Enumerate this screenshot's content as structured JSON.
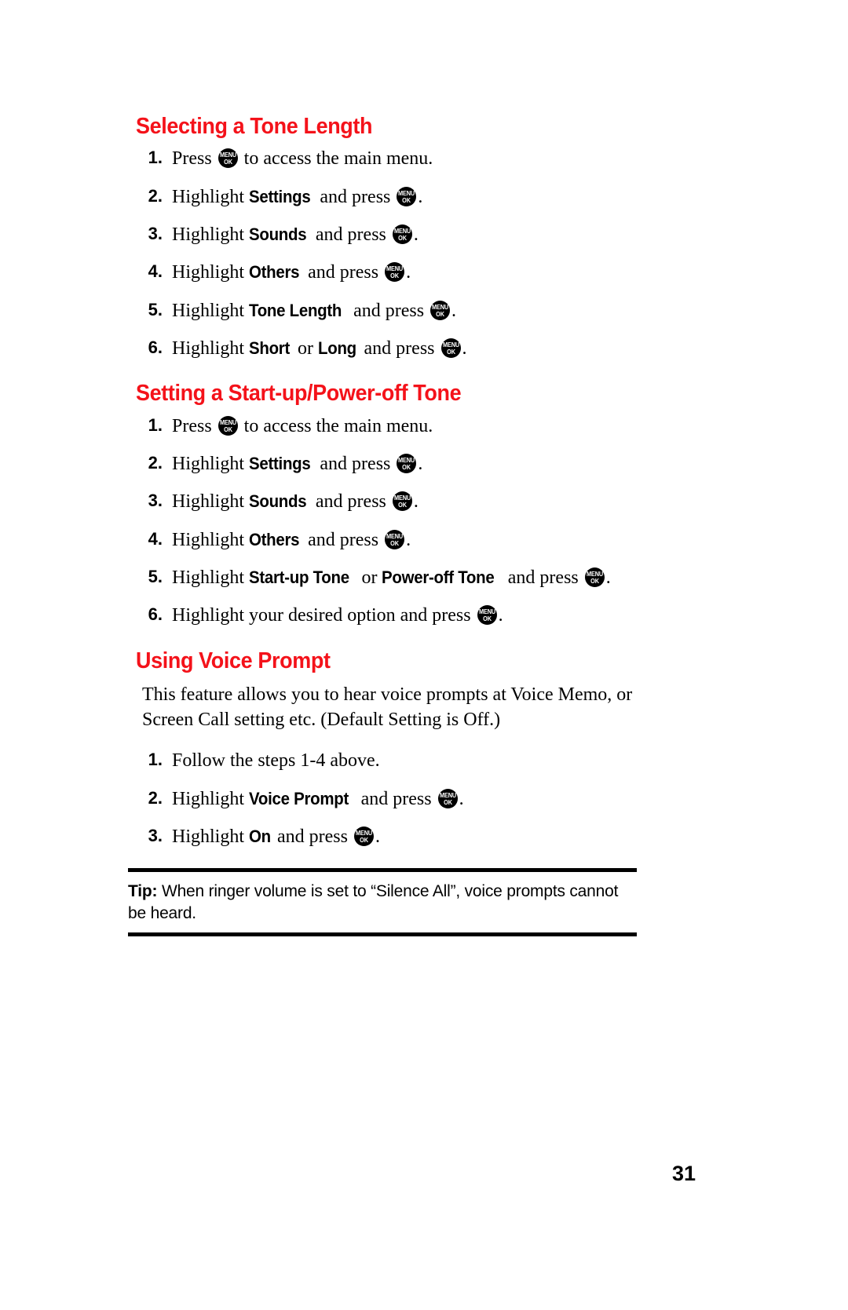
{
  "page": {
    "folio": "31",
    "heading_color": "#F4121A",
    "text_color": "#000000",
    "background": "#FFFFFF"
  },
  "key_glyph": {
    "name": "menu-ok-key",
    "top_label": "MENU",
    "bottom_label": "OK"
  },
  "sections": [
    {
      "id": "selecting-a-tone-length",
      "heading": "Selecting a Tone Length",
      "steps": [
        {
          "num": "1.",
          "pre": "Press ",
          "key": true,
          "post": " to access the main menu."
        },
        {
          "num": "2.",
          "pre": "Highlight ",
          "bold": "Settings",
          "mid": " and press ",
          "key": true,
          "post": "."
        },
        {
          "num": "3.",
          "pre": "Highlight ",
          "bold": "Sounds",
          "mid": " and press ",
          "key": true,
          "post": "."
        },
        {
          "num": "4.",
          "pre": "Highlight ",
          "bold": "Others",
          "mid": " and press ",
          "key": true,
          "post": "."
        },
        {
          "num": "5.",
          "pre": "Highlight ",
          "bold": "Tone Length",
          "mid": " and press ",
          "key": true,
          "post": "."
        },
        {
          "num": "6.",
          "pre": "Highlight ",
          "bold": "Short",
          "mid2": " or ",
          "bold2": "Long",
          "mid": " and press ",
          "key": true,
          "post": "."
        }
      ]
    },
    {
      "id": "setting-a-start-up-power-off-tone",
      "heading": "Setting a Start-up/Power-off Tone",
      "steps": [
        {
          "num": "1.",
          "pre": "Press ",
          "key": true,
          "post": " to access the main menu."
        },
        {
          "num": "2.",
          "pre": "Highlight ",
          "bold": "Settings",
          "mid": " and press ",
          "key": true,
          "post": "."
        },
        {
          "num": "3.",
          "pre": "Highlight ",
          "bold": "Sounds",
          "mid": " and press ",
          "key": true,
          "post": "."
        },
        {
          "num": "4.",
          "pre": "Highlight ",
          "bold": "Others",
          "mid": " and press ",
          "key": true,
          "post": "."
        },
        {
          "num": "5.",
          "pre": "Highlight ",
          "bold": "Start-up Tone",
          "mid2": " or ",
          "bold2": "Power-off Tone",
          "mid": " and press ",
          "key": true,
          "post": "."
        },
        {
          "num": "6.",
          "pre": "Highlight your desired option and press ",
          "key": true,
          "post": "."
        }
      ]
    },
    {
      "id": "using-voice-prompt",
      "heading": "Using Voice Prompt",
      "intro": "This feature allows you to hear voice prompts at Voice Memo, or Screen Call setting etc. (Default Setting is Off.)",
      "steps": [
        {
          "num": "1.",
          "pre": "Follow the steps 1-4 above."
        },
        {
          "num": "2.",
          "pre": "Highlight ",
          "bold": "Voice Prompt",
          "mid": " and press ",
          "key": true,
          "post": "."
        },
        {
          "num": "3.",
          "pre": "Highlight ",
          "bold": "On",
          "mid": " and press ",
          "key": true,
          "post": "."
        }
      ]
    }
  ],
  "tip": {
    "label": "Tip:",
    "text": " When ringer volume is set to “Silence All”, voice prompts cannot be heard."
  }
}
